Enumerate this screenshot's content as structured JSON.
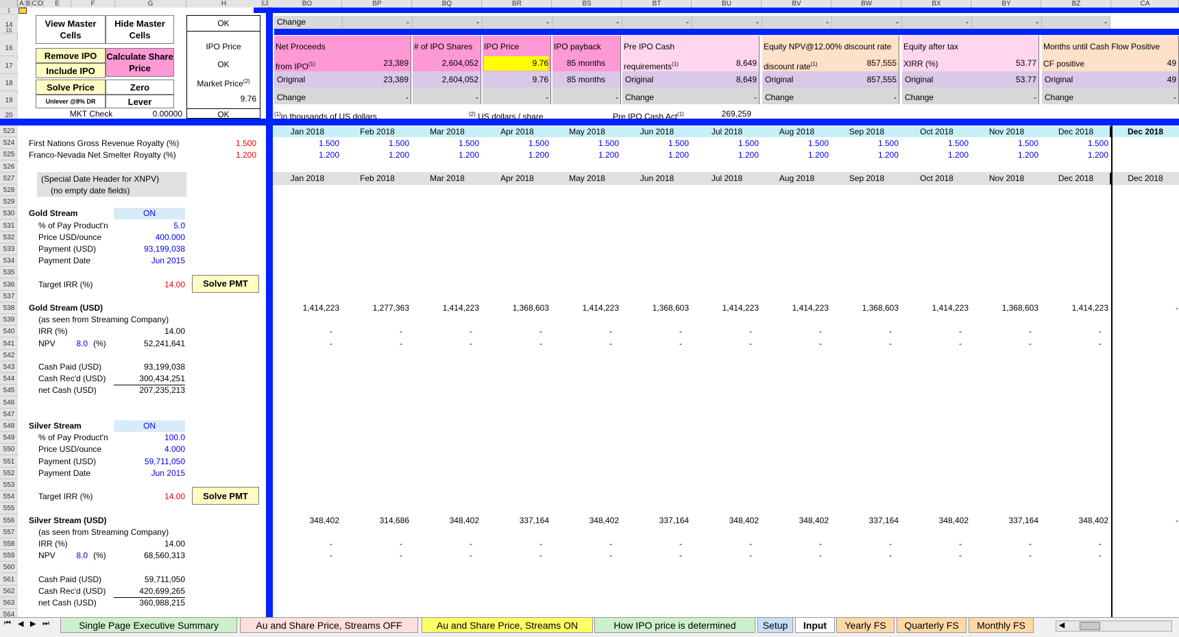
{
  "col_letters": {
    "left": [
      "A",
      "B",
      "C",
      "D",
      "E",
      "F",
      "G",
      "H",
      "I",
      "J"
    ],
    "right": [
      "BO",
      "BP",
      "BQ",
      "BR",
      "BS",
      "BT",
      "BU",
      "BV",
      "BW",
      "BX",
      "BY",
      "BZ",
      "CA"
    ]
  },
  "row_numbers": [
    "1",
    "14",
    "15",
    "16",
    "17",
    "18",
    "19",
    "20",
    "21",
    "523",
    "524",
    "525",
    "526",
    "527",
    "528",
    "529",
    "530",
    "531",
    "532",
    "533",
    "534",
    "535",
    "536",
    "537",
    "538",
    "539",
    "540",
    "541",
    "542",
    "543",
    "544",
    "545",
    "546",
    "547",
    "548",
    "549",
    "550",
    "551",
    "552",
    "553",
    "554",
    "555",
    "556",
    "557",
    "558",
    "559",
    "560",
    "561",
    "562",
    "563",
    "564"
  ],
  "buttons": {
    "view_master": "View Master Cells",
    "hide_master": "Hide Master Cells",
    "remove_ipo": "Remove IPO",
    "calc_share": "Calculate Share Price",
    "include_ipo": "Include IPO",
    "solve_price": "Solve Price",
    "zero": "Zero",
    "unlever": "Unlever @8% DR",
    "lever": "Lever",
    "solve_pmt": "Solve PMT"
  },
  "left_panel": {
    "mkt_check_label": "MKT Check",
    "mkt_check_value": "0.00000",
    "ok1": "OK",
    "ipo_price_label": "IPO Price",
    "ok2": "OK",
    "market_price_label": "Market Price",
    "market_price_sup": "(2)",
    "market_price_value": "9.76",
    "ok3": "OK"
  },
  "summary": {
    "change_row": [
      "Change",
      "-",
      "-",
      "-",
      "-",
      "-",
      "-",
      "-",
      "-",
      "-",
      "-",
      "-"
    ],
    "net_proceeds_label": "Net Proceeds",
    "net_proceeds_sub": "from IPO",
    "net_proceeds_value": "23,389",
    "shares_label": "# of IPO Shares",
    "shares_value": "2,604,052",
    "ipo_price_label": "IPO Price",
    "ipo_price_value": "9.76",
    "payback_label": "IPO payback",
    "payback_value": "85 months",
    "pre_ipo_label": "Pre IPO Cash",
    "pre_ipo_sub": "requirements",
    "pre_ipo_value": "8,649",
    "equity_npv_label": "Equity NPV@12.00% discount rate",
    "equity_npv_sub": "discount rate",
    "equity_npv_value": "857,555",
    "equity_tax_label": "Equity after tax",
    "equity_tax_sub": "XIRR (%)",
    "equity_tax_value": "53.77",
    "months_label": "Months until Cash Flow Positive",
    "months_sub": "CF positive",
    "months_value": "49",
    "original": "Original",
    "change": "Change",
    "sup1": "(1)",
    "sup2": "(2)",
    "footnote1": "in thousands of  US dollars",
    "footnote2": "US dollars / share",
    "pre_ipo_act_label": "Pre IPO Cash Act",
    "pre_ipo_act_value": "269,259"
  },
  "months": [
    "Jan 2018",
    "Feb 2018",
    "Mar 2018",
    "Apr 2018",
    "May 2018",
    "Jun 2018",
    "Jul 2018",
    "Aug 2018",
    "Sep 2018",
    "Oct 2018",
    "Nov 2018",
    "Dec 2018",
    "Dec 2018"
  ],
  "royalties": {
    "fn_label": "First Nations Gross Revenue Royalty (%)",
    "fn_value": "1.500",
    "fv_label": "Franco-Nevada Net Smelter Royalty (%)",
    "fv_value": "1.200"
  },
  "special_header": {
    "line1": "(Special Date Header for XNPV)",
    "line2": "(no empty date fields)"
  },
  "gold": {
    "title": "Gold Stream",
    "on": "ON",
    "pay_label": "% of Pay Product'n",
    "pay_value": "5.0",
    "price_label": "Price USD/ounce",
    "price_value": "400.000",
    "payment_label": "Payment (USD)",
    "payment_value": "93,199,038",
    "date_label": "Payment Date",
    "date_value": "Jun 2015",
    "irr_label": "Target IRR (%)",
    "irr_value": "14.00",
    "usd_title": "Gold Stream (USD)",
    "seen": "(as seen from Streaming Company)",
    "irr2_label": "IRR (%)",
    "irr2_value": "14.00",
    "npv_label": "NPV",
    "npv_rate": "8.0",
    "npv_pct": "(%)",
    "npv_value": "52,241,641",
    "paid_label": "Cash Paid (USD)",
    "paid_value": "93,199,038",
    "recd_label": "Cash Rec'd (USD)",
    "recd_value": "300,434,251",
    "net_label": "net Cash (USD)",
    "net_value": "207,235,213",
    "monthly": [
      "1,414,223",
      "1,277,363",
      "1,414,223",
      "1,368,603",
      "1,414,223",
      "1,368,603",
      "1,414,223",
      "1,414,223",
      "1,368,603",
      "1,414,223",
      "1,368,603",
      "1,414,223",
      "-"
    ]
  },
  "silver": {
    "title": "Silver Stream",
    "on": "ON",
    "pay_label": "% of Pay Product'n",
    "pay_value": "100.0",
    "price_label": "Price USD/ounce",
    "price_value": "4.000",
    "payment_label": "Payment (USD)",
    "payment_value": "59,711,050",
    "date_label": "Payment Date",
    "date_value": "Jun 2015",
    "irr_label": "Target IRR (%)",
    "irr_value": "14.00",
    "usd_title": "Silver Stream (USD)",
    "seen": "(as seen from Streaming Company)",
    "irr2_label": "IRR (%)",
    "irr2_value": "14.00",
    "npv_label": "NPV",
    "npv_rate": "8.0",
    "npv_pct": "(%)",
    "npv_value": "68,560,313",
    "paid_label": "Cash Paid (USD)",
    "paid_value": "59,711,050",
    "recd_label": "Cash Rec'd (USD)",
    "recd_value": "420,699,265",
    "net_label": "net Cash (USD)",
    "net_value": "360,988,215",
    "monthly": [
      "348,402",
      "314,686",
      "348,402",
      "337,164",
      "348,402",
      "337,164",
      "348,402",
      "348,402",
      "337,164",
      "348,402",
      "337,164",
      "348,402",
      "-"
    ]
  },
  "sheet_tabs": [
    "Single Page  Executive Summary",
    "Au and Share Price, Streams OFF",
    "Au and Share Price, Streams ON",
    "How IPO price is determined",
    "Setup",
    "Input",
    "Yearly FS",
    "Quarterly FS",
    "Monthly FS"
  ],
  "colors": {
    "blue_bar": "#0022ff",
    "pink": "#ff99d6",
    "lavender": "#d9c8e8",
    "yellow": "#ffff00",
    "peach": "#ffe0c8",
    "month_header": "#c6f0f8"
  }
}
